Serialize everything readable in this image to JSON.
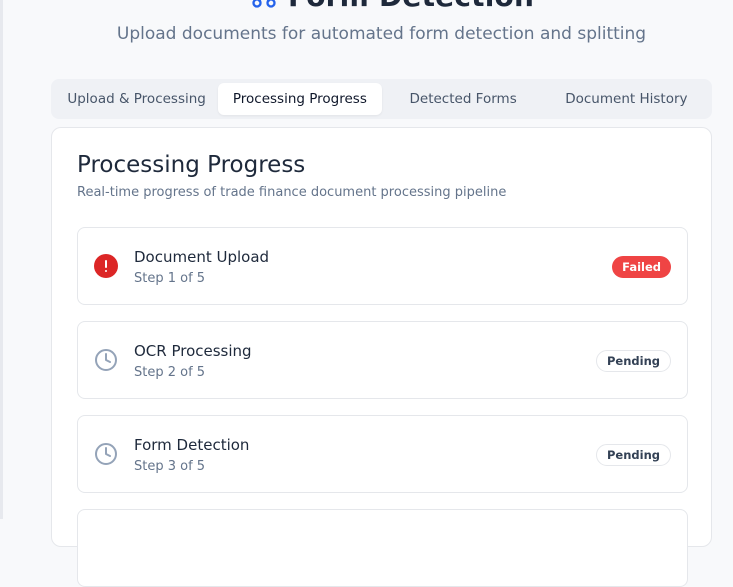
{
  "header": {
    "title": "Form Detection",
    "subtitle": "Upload documents for automated form detection and splitting"
  },
  "tabs": [
    {
      "label": "Upload & Processing",
      "active": false
    },
    {
      "label": "Processing Progress",
      "active": true
    },
    {
      "label": "Detected Forms",
      "active": false
    },
    {
      "label": "Document History",
      "active": false
    }
  ],
  "progress": {
    "title": "Processing Progress",
    "description": "Real-time progress of trade finance document processing pipeline",
    "steps": [
      {
        "name": "Document Upload",
        "sub": "Step 1 of 5",
        "status": "Failed",
        "icon": "error-icon"
      },
      {
        "name": "OCR Processing",
        "sub": "Step 2 of 5",
        "status": "Pending",
        "icon": "clock-icon"
      },
      {
        "name": "Form Detection",
        "sub": "Step 3 of 5",
        "status": "Pending",
        "icon": "clock-icon"
      }
    ]
  },
  "colors": {
    "accent": "#2563eb",
    "failed": "#ef4444",
    "error_icon": "#dc2626",
    "muted": "#64748b"
  }
}
